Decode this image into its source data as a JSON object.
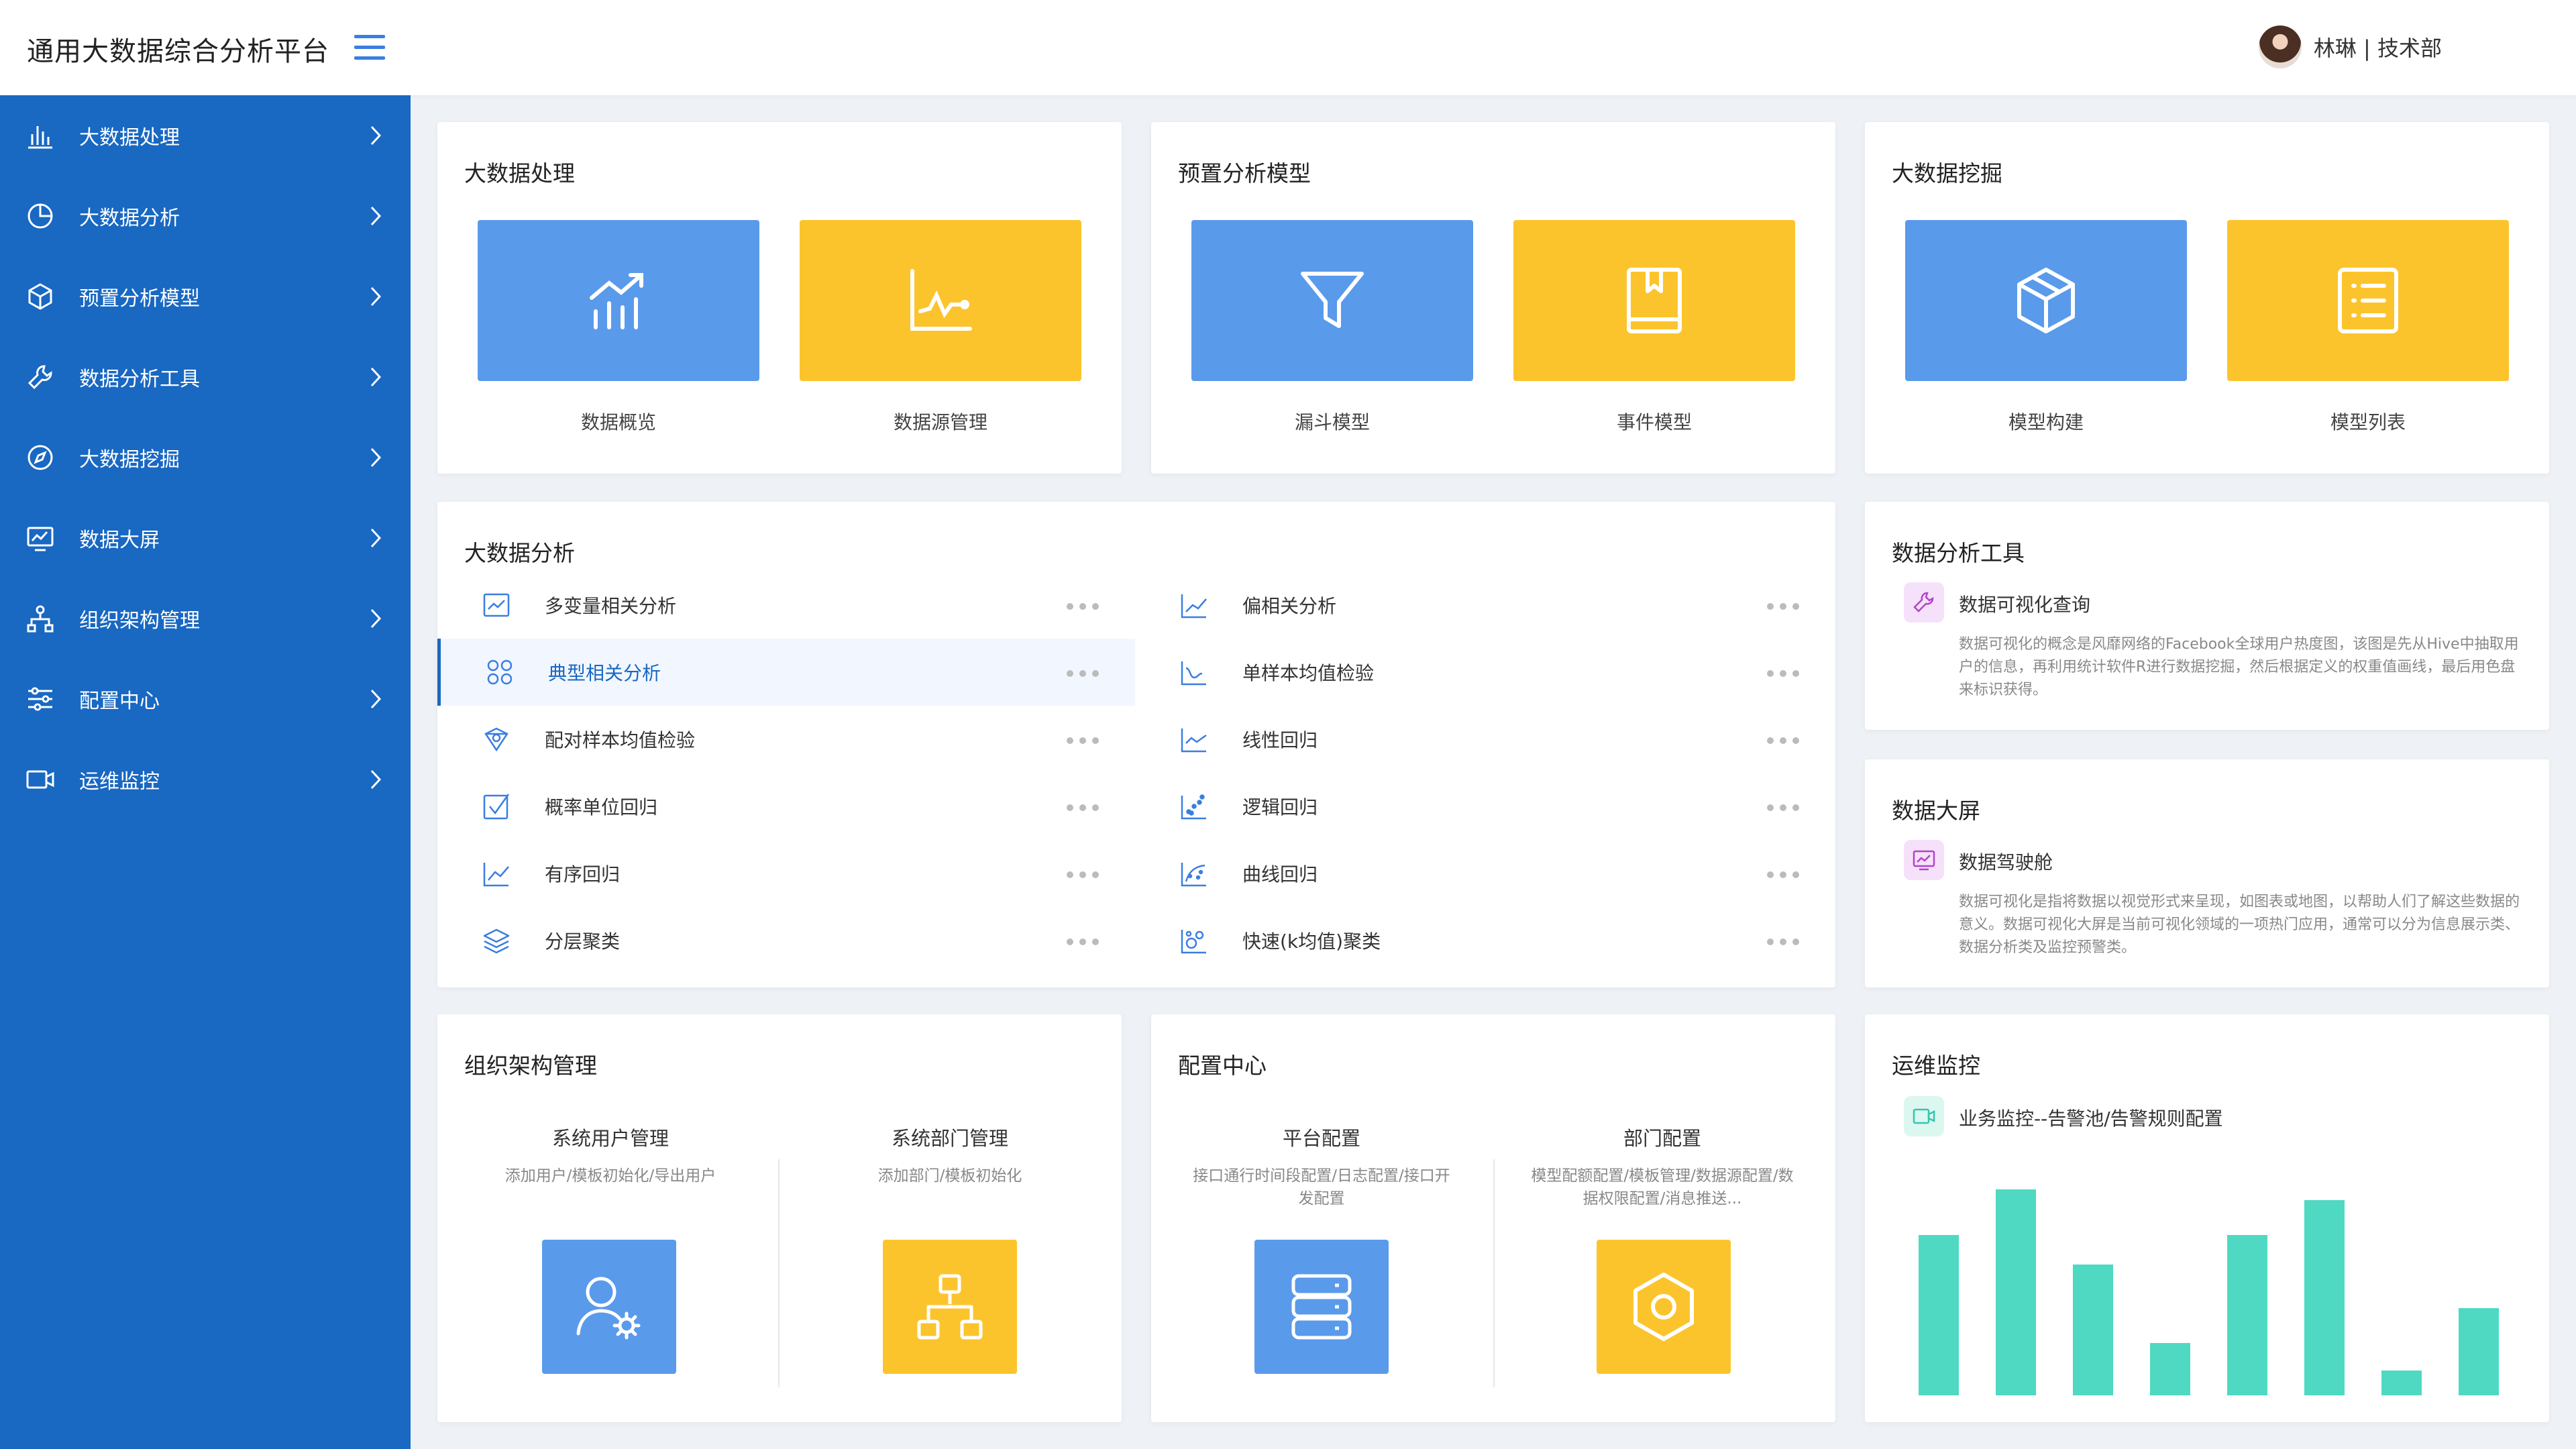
{
  "header": {
    "title": "通用大数据综合分析平台",
    "user": "林琳 | 技术部"
  },
  "sidebar": {
    "items": [
      {
        "label": "大数据处理",
        "icon": "bar-chart-icon"
      },
      {
        "label": "大数据分析",
        "icon": "pie-chart-icon"
      },
      {
        "label": "预置分析模型",
        "icon": "cube-icon"
      },
      {
        "label": "数据分析工具",
        "icon": "wrench-icon"
      },
      {
        "label": "大数据挖掘",
        "icon": "compass-icon"
      },
      {
        "label": "数据大屏",
        "icon": "monitor-chart-icon"
      },
      {
        "label": "组织架构管理",
        "icon": "org-tree-icon"
      },
      {
        "label": "配置中心",
        "icon": "sliders-icon"
      },
      {
        "label": "运维监控",
        "icon": "camera-icon"
      }
    ]
  },
  "processing": {
    "title": "大数据处理",
    "tiles": [
      {
        "label": "数据概览",
        "icon": "growth-chart-icon"
      },
      {
        "label": "数据源管理",
        "icon": "line-chart-icon"
      }
    ]
  },
  "models": {
    "title": "预置分析模型",
    "tiles": [
      {
        "label": "漏斗模型",
        "icon": "funnel-icon"
      },
      {
        "label": "事件模型",
        "icon": "book-icon"
      }
    ]
  },
  "mining": {
    "title": "大数据挖掘",
    "tiles": [
      {
        "label": "模型构建",
        "icon": "cube-icon"
      },
      {
        "label": "模型列表",
        "icon": "list-icon"
      }
    ]
  },
  "analysis": {
    "title": "大数据分析",
    "left": [
      {
        "label": "多变量相关分析"
      },
      {
        "label": "典型相关分析"
      },
      {
        "label": "配对样本均值检验"
      },
      {
        "label": "概率单位回归"
      },
      {
        "label": "有序回归"
      },
      {
        "label": "分层聚类"
      }
    ],
    "right": [
      {
        "label": "偏相关分析"
      },
      {
        "label": "单样本均值检验"
      },
      {
        "label": "线性回归"
      },
      {
        "label": "逻辑回归"
      },
      {
        "label": "曲线回归"
      },
      {
        "label": "快速(k均值)聚类"
      }
    ]
  },
  "tools": {
    "title": "数据分析工具",
    "item_name": "数据可视化查询",
    "item_desc": "数据可视化的概念是风靡网络的Facebook全球用户热度图，该图是先从Hive中抽取用户的信息，再利用统计软件R进行数据挖掘，然后根据定义的权重值画线，最后用色盘来标识获得。"
  },
  "screen": {
    "title": "数据大屏",
    "item_name": "数据驾驶舱",
    "item_desc": "数据可视化是指将数据以视觉形式来呈现，如图表或地图，以帮助人们了解这些数据的意义。数据可视化大屏是当前可视化领域的一项热门应用，通常可以分为信息展示类、数据分析类及监控预警类。"
  },
  "org": {
    "title": "组织架构管理",
    "users_title": "系统用户管理",
    "users_desc": "添加用户/模板初始化/导出用户",
    "depts_title": "系统部门管理",
    "depts_desc": "添加部门/模板初始化"
  },
  "config": {
    "title": "配置中心",
    "platform_title": "平台配置",
    "platform_desc": "接口通行时间段配置/日志配置/接口开发配置",
    "dept_title": "部门配置",
    "dept_desc": "模型配额配置/模板管理/数据源配置/数据权限配置/消息推送..."
  },
  "monitor": {
    "title": "运维监控",
    "subtitle": "业务监控--告警池/告警规则配置",
    "chart_data": {
      "type": "bar",
      "values": [
        0.77,
        0.99,
        0.63,
        0.25,
        0.77,
        0.94,
        0.12,
        0.42
      ],
      "ylim": [
        0,
        1
      ]
    }
  },
  "colors": {
    "sidebar": "#1968c2",
    "tile_blue": "#5a9aeb",
    "tile_yellow": "#fcc42c",
    "bar": "#4fd9c2"
  }
}
